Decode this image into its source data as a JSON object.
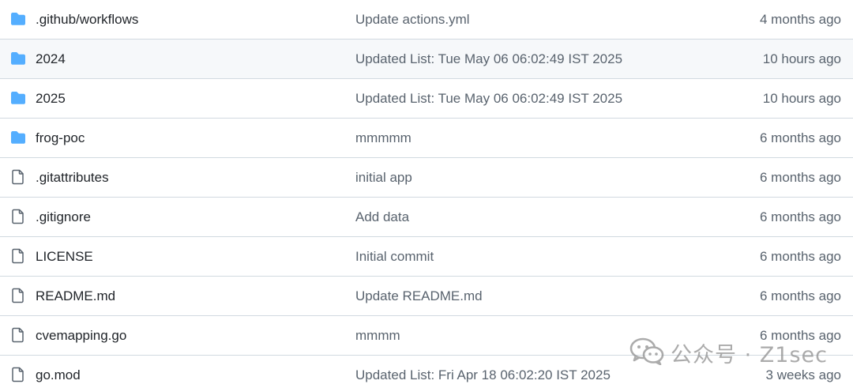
{
  "files": [
    {
      "type": "folder",
      "name": ".github/workflows",
      "commit": "Update actions.yml",
      "age": "4 months ago"
    },
    {
      "type": "folder",
      "name": "2024",
      "commit": "Updated List: Tue May 06 06:02:49 IST 2025",
      "age": "10 hours ago"
    },
    {
      "type": "folder",
      "name": "2025",
      "commit": "Updated List: Tue May 06 06:02:49 IST 2025",
      "age": "10 hours ago"
    },
    {
      "type": "folder",
      "name": "frog-poc",
      "commit": "mmmmm",
      "age": "6 months ago"
    },
    {
      "type": "file",
      "name": ".gitattributes",
      "commit": "initial app",
      "age": "6 months ago"
    },
    {
      "type": "file",
      "name": ".gitignore",
      "commit": "Add data",
      "age": "6 months ago"
    },
    {
      "type": "file",
      "name": "LICENSE",
      "commit": "Initial commit",
      "age": "6 months ago"
    },
    {
      "type": "file",
      "name": "README.md",
      "commit": "Update README.md",
      "age": "6 months ago"
    },
    {
      "type": "file",
      "name": "cvemapping.go",
      "commit": "mmmm",
      "age": "6 months ago"
    },
    {
      "type": "file",
      "name": "go.mod",
      "commit": "Updated List: Fri Apr 18 06:02:20 IST 2025",
      "age": "3 weeks ago"
    }
  ],
  "icons": {
    "folder": "folder-icon",
    "file": "file-icon"
  },
  "colors": {
    "folder": "#54aeff",
    "file_icon": "#59636e",
    "name_text": "#1f2328",
    "muted_text": "#59636e",
    "border": "#d1d9e0",
    "row_hover": "#f6f8fa"
  },
  "watermark": {
    "text": "公众号 · Z1sec"
  }
}
